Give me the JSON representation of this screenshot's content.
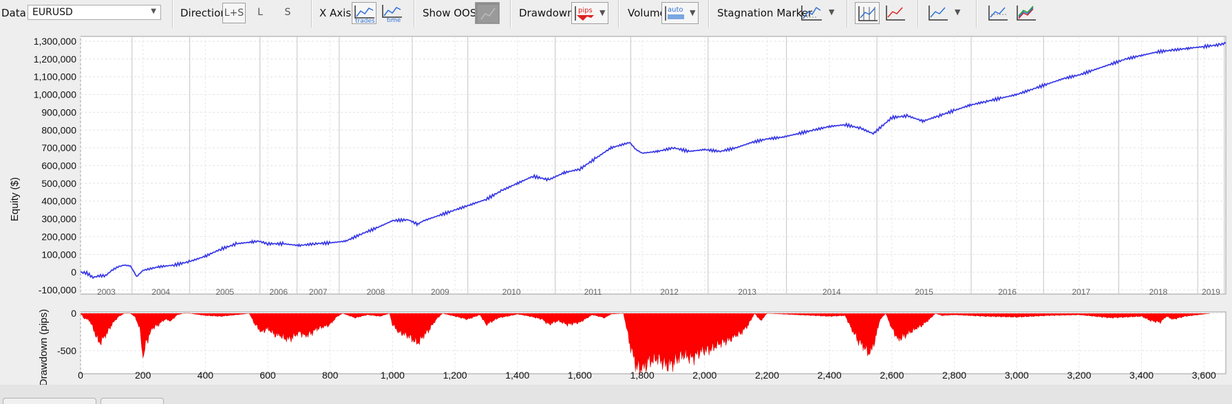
{
  "toolbar": {
    "data_label": "Data",
    "data_value": "EURUSD",
    "direction_label": "Direction",
    "direction_options": [
      "L+S",
      "L",
      "S"
    ],
    "direction_selected": "L+S",
    "xaxis_label": "X Axis",
    "xaxis_trades_icon_text": "trades",
    "xaxis_time_icon_text": "time",
    "show_oos_label": "Show OOS",
    "drawdown_label": "Drawdown",
    "drawdown_icon_text": "pips",
    "volume_label": "Volume",
    "volume_icon_text": "auto",
    "stagnation_label": "Stagnation Marker",
    "icons": [
      "trades-axis-icon",
      "time-axis-icon",
      "oos-icon",
      "drawdown-pips-icon",
      "volume-auto-icon",
      "stagnation-marker-icon",
      "chart-grid-icon",
      "chart-red-line-icon",
      "chart-line-icon",
      "chart-compare-icon",
      "chart-multi-series-icon"
    ]
  },
  "chart_data": [
    {
      "type": "line",
      "ylabel": "Equity ($)",
      "xlabel": "",
      "color": "#3b3be6",
      "ylim": [
        -100000,
        1300000
      ],
      "yticks": [
        -100000,
        0,
        100000,
        200000,
        300000,
        400000,
        500000,
        600000,
        700000,
        800000,
        900000,
        1000000,
        1100000,
        1200000,
        1300000
      ],
      "ytick_labels": [
        "-100,000",
        "0",
        "100,000",
        "200,000",
        "300,000",
        "400,000",
        "500,000",
        "600,000",
        "700,000",
        "800,000",
        "900,000",
        "1,000,000",
        "1,100,000",
        "1,200,000",
        "1,300,000"
      ],
      "grid": true,
      "year_markers": [
        {
          "label": "2003",
          "start": 0
        },
        {
          "label": "2004",
          "start": 165
        },
        {
          "label": "2005",
          "start": 350
        },
        {
          "label": "2006",
          "start": 575
        },
        {
          "label": "2007",
          "start": 694
        },
        {
          "label": "2008",
          "start": 829
        },
        {
          "label": "2009",
          "start": 1063
        },
        {
          "label": "2010",
          "start": 1241
        },
        {
          "label": "2011",
          "start": 1521
        },
        {
          "label": "2012",
          "start": 1763
        },
        {
          "label": "2013",
          "start": 2011
        },
        {
          "label": "2014",
          "start": 2262
        },
        {
          "label": "2015",
          "start": 2552
        },
        {
          "label": "2016",
          "start": 2854
        },
        {
          "label": "2017",
          "start": 3086
        },
        {
          "label": "2018",
          "start": 3327
        },
        {
          "label": "2019",
          "start": 3580
        },
        {
          "label": "",
          "start": 3665
        }
      ],
      "x": [
        0,
        20,
        40,
        60,
        80,
        100,
        120,
        140,
        160,
        180,
        200,
        250,
        300,
        350,
        400,
        450,
        500,
        550,
        570,
        600,
        650,
        700,
        750,
        800,
        850,
        900,
        950,
        1000,
        1050,
        1080,
        1100,
        1150,
        1200,
        1250,
        1300,
        1350,
        1400,
        1450,
        1500,
        1550,
        1600,
        1650,
        1700,
        1740,
        1760,
        1780,
        1800,
        1850,
        1900,
        1950,
        2000,
        2050,
        2100,
        2150,
        2200,
        2250,
        2300,
        2350,
        2400,
        2450,
        2500,
        2540,
        2560,
        2600,
        2650,
        2700,
        2750,
        2800,
        2850,
        2900,
        2950,
        3000,
        3050,
        3100,
        3150,
        3200,
        3250,
        3300,
        3350,
        3400,
        3450,
        3500,
        3550,
        3600,
        3650,
        3670
      ],
      "y": [
        0,
        -5000,
        -30000,
        -20000,
        -20000,
        10000,
        30000,
        40000,
        35000,
        -25000,
        10000,
        30000,
        40000,
        60000,
        90000,
        130000,
        160000,
        170000,
        175000,
        160000,
        160000,
        150000,
        160000,
        165000,
        175000,
        215000,
        250000,
        290000,
        295000,
        270000,
        290000,
        320000,
        350000,
        380000,
        410000,
        460000,
        500000,
        540000,
        520000,
        560000,
        580000,
        640000,
        700000,
        720000,
        730000,
        690000,
        670000,
        680000,
        700000,
        680000,
        690000,
        680000,
        700000,
        730000,
        750000,
        760000,
        780000,
        800000,
        820000,
        830000,
        810000,
        780000,
        810000,
        870000,
        880000,
        850000,
        880000,
        910000,
        940000,
        960000,
        980000,
        1000000,
        1030000,
        1060000,
        1090000,
        1110000,
        1140000,
        1170000,
        1200000,
        1220000,
        1240000,
        1250000,
        1260000,
        1270000,
        1280000,
        1290000
      ]
    },
    {
      "type": "area",
      "ylabel": "Drawdown (pips)",
      "xlabel": "",
      "color": "#ff0000",
      "ylim": [
        -800,
        0
      ],
      "yticks": [
        0,
        -500
      ],
      "ytick_labels": [
        "0",
        "-500"
      ],
      "xlim": [
        0,
        3670
      ],
      "xticks": [
        0,
        200,
        400,
        600,
        800,
        1000,
        1200,
        1400,
        1600,
        1800,
        2000,
        2200,
        2400,
        2600,
        2800,
        3000,
        3200,
        3400,
        3600
      ],
      "xtick_labels": [
        "0",
        "200",
        "400",
        "600",
        "800",
        "1,000",
        "1,200",
        "1,400",
        "1,600",
        "1,800",
        "2,000",
        "2,200",
        "2,400",
        "2,600",
        "2,800",
        "3,000",
        "3,200",
        "3,400",
        "3,600"
      ],
      "grid": true,
      "x": [
        0,
        10,
        30,
        60,
        80,
        100,
        120,
        140,
        160,
        175,
        190,
        200,
        210,
        230,
        250,
        270,
        290,
        310,
        330,
        350,
        400,
        450,
        500,
        540,
        560,
        580,
        600,
        620,
        640,
        660,
        680,
        700,
        720,
        740,
        760,
        780,
        800,
        820,
        840,
        880,
        920,
        960,
        990,
        1000,
        1020,
        1050,
        1080,
        1100,
        1120,
        1140,
        1160,
        1200,
        1240,
        1280,
        1300,
        1340,
        1380,
        1400,
        1440,
        1480,
        1500,
        1530,
        1560,
        1600,
        1640,
        1680,
        1700,
        1740,
        1760,
        1780,
        1800,
        1820,
        1850,
        1880,
        1900,
        1930,
        1960,
        1990,
        2020,
        2050,
        2080,
        2100,
        2120,
        2140,
        2160,
        2180,
        2200,
        2300,
        2400,
        2450,
        2470,
        2490,
        2510,
        2530,
        2550,
        2560,
        2580,
        2600,
        2620,
        2640,
        2660,
        2680,
        2700,
        2720,
        2740,
        2760,
        2800,
        2900,
        3000,
        3100,
        3200,
        3300,
        3400,
        3430,
        3460,
        3480,
        3500,
        3540,
        3580,
        3620,
        3670
      ],
      "y": [
        0,
        -60,
        -100,
        -400,
        -300,
        -150,
        -50,
        0,
        0,
        -50,
        -200,
        -600,
        -400,
        -200,
        -150,
        -80,
        -100,
        -20,
        0,
        0,
        -30,
        -40,
        -20,
        0,
        -150,
        -250,
        -200,
        -280,
        -300,
        -350,
        -320,
        -250,
        -300,
        -260,
        -200,
        -180,
        -150,
        -50,
        0,
        -60,
        -20,
        -40,
        0,
        -150,
        -250,
        -300,
        -400,
        -300,
        -200,
        -80,
        0,
        -40,
        -80,
        -20,
        -150,
        -60,
        -30,
        -10,
        -40,
        -80,
        -150,
        -100,
        -150,
        -120,
        -20,
        -60,
        -10,
        0,
        -400,
        -700,
        -750,
        -650,
        -600,
        -700,
        -650,
        -550,
        -600,
        -500,
        -480,
        -400,
        -350,
        -300,
        -250,
        -150,
        0,
        -100,
        0,
        -20,
        -40,
        -30,
        -200,
        -350,
        -450,
        -550,
        -300,
        -100,
        0,
        -200,
        -350,
        -300,
        -250,
        -200,
        -150,
        -80,
        0,
        -30,
        -20,
        -40,
        -50,
        -30,
        -20,
        -60,
        -40,
        -100,
        -120,
        -40,
        -80,
        -40,
        -20,
        0
      ]
    }
  ]
}
